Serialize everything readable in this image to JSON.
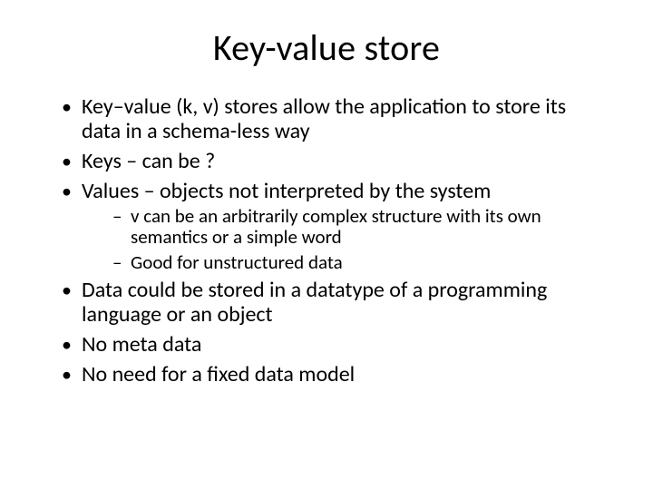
{
  "slide": {
    "title": "Key-value store",
    "bullets": [
      "Key–value (k, v) stores allow the application to store its data in a schema-less way",
      "Keys – can be ?",
      "Values – objects not interpreted by the system"
    ],
    "sub_bullets": [
      "v can be an arbitrarily complex structure with its own semantics or a simple word",
      "Good for unstructured data"
    ],
    "bullets_tail": [
      "Data could be stored in a datatype of a programming language or an object",
      "No meta data",
      "No need for a fixed data model"
    ]
  }
}
